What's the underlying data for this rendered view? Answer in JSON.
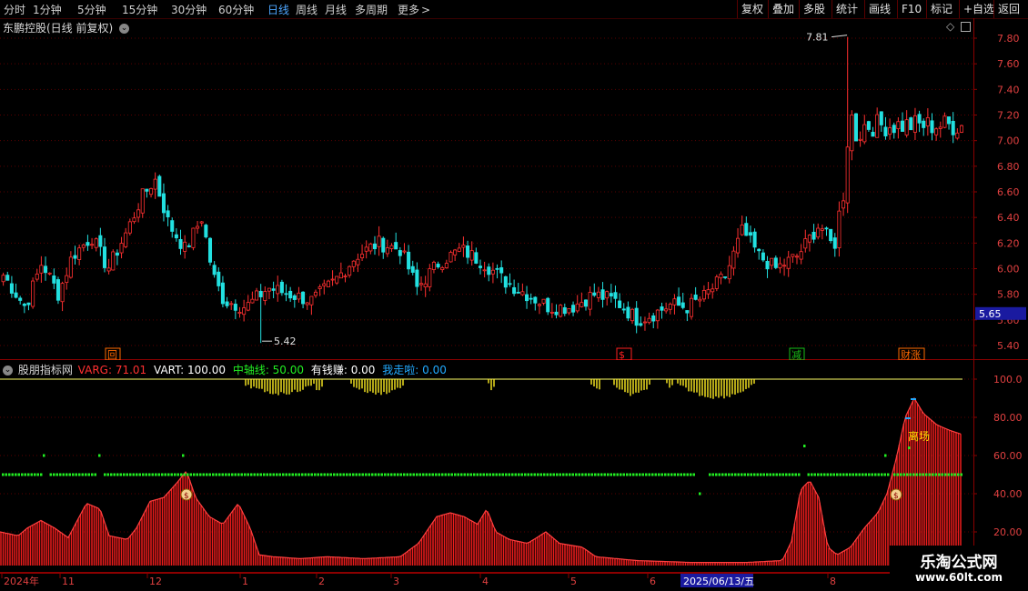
{
  "toolbar": {
    "periods": [
      "分时",
      "1分钟",
      "5分钟",
      "15分钟",
      "30分钟",
      "60分钟",
      "日线",
      "周线",
      "月线",
      "多周期",
      "更多"
    ],
    "active_period": "日线",
    "more_arrow": ">",
    "buttons": [
      "复权",
      "叠加",
      "多股",
      "统计",
      "画线",
      "F10",
      "标记",
      "+自选",
      "返回"
    ]
  },
  "main": {
    "title": "东鹏控股(日线 前复权)",
    "high_label": "7.81",
    "low_label": "5.42",
    "current_price": "5.65",
    "yaxis_ticks": [
      "7.80",
      "7.60",
      "7.40",
      "7.20",
      "7.00",
      "6.80",
      "6.60",
      "6.40",
      "6.20",
      "6.00",
      "5.80",
      "5.60",
      "5.40"
    ],
    "markers": [
      {
        "text": "回",
        "color": "#ff6a00"
      },
      {
        "text": "$",
        "color": "#ff2020"
      },
      {
        "text": "减",
        "color": "#18c018"
      },
      {
        "text": "财涨",
        "color": "#ff6a00"
      }
    ]
  },
  "indicator": {
    "name": "股朋指标网",
    "legend": [
      {
        "text": "VARG: 71.01",
        "color": "#ff3030"
      },
      {
        "text": "VART: 100.00",
        "color": "#ffffff"
      },
      {
        "text": "中轴线: 50.00",
        "color": "#22ee22"
      },
      {
        "text": "有钱赚: 0.00",
        "color": "#ffffff"
      },
      {
        "text": "我走啦: 0.00",
        "color": "#22aaff"
      }
    ],
    "yaxis_ticks": [
      "100.0",
      "80.00",
      "60.00",
      "40.00",
      "20.00"
    ],
    "exit_label": "离场"
  },
  "xaxis": {
    "labels": [
      "2024年",
      "11",
      "12",
      "1",
      "2",
      "3",
      "4",
      "5",
      "6",
      "8"
    ],
    "cursor_date": "2025/06/13/五"
  },
  "watermark": {
    "line1": "乐淘公式网",
    "line2": "www.60lt.com"
  },
  "colors": {
    "up": "#ff3030",
    "down": "#22e0e0",
    "grid": "#5a0000",
    "axis": "#8b0000"
  }
}
